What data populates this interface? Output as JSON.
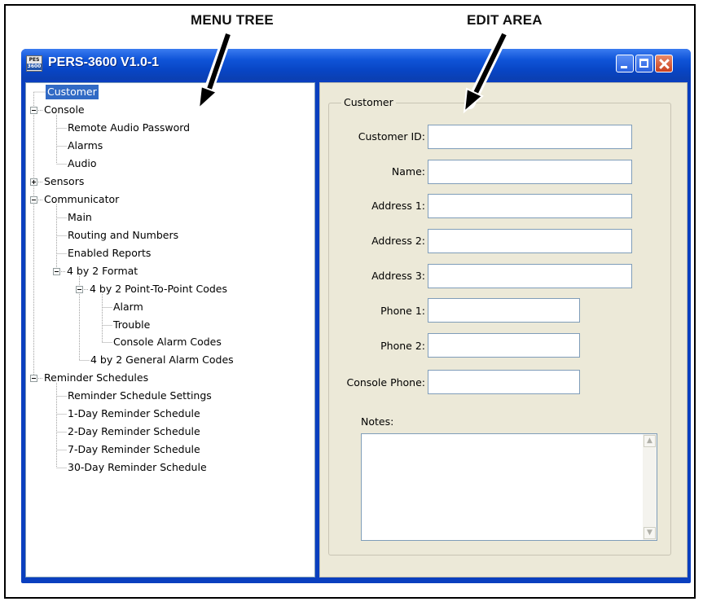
{
  "callouts": {
    "menu_tree": "MENU TREE",
    "edit_area": "EDIT AREA"
  },
  "window": {
    "title": "PERS-3600 V1.0-1",
    "icon_text_top": "PES",
    "icon_text_bottom": "3600",
    "icons": [
      "app-icon",
      "minimize-icon",
      "maximize-icon",
      "close-icon"
    ]
  },
  "tree": {
    "items": [
      {
        "label": "Customer",
        "selected": true
      },
      {
        "label": "Console",
        "expander": "minus"
      },
      {
        "label": "Remote Audio Password"
      },
      {
        "label": "Alarms"
      },
      {
        "label": "Audio"
      },
      {
        "label": "Sensors",
        "expander": "plus"
      },
      {
        "label": "Communicator",
        "expander": "minus"
      },
      {
        "label": "Main"
      },
      {
        "label": "Routing and Numbers"
      },
      {
        "label": "Enabled Reports"
      },
      {
        "label": "4 by 2 Format",
        "expander": "minus"
      },
      {
        "label": "4 by 2 Point-To-Point Codes",
        "expander": "minus"
      },
      {
        "label": "Alarm"
      },
      {
        "label": "Trouble"
      },
      {
        "label": "Console Alarm Codes"
      },
      {
        "label": "4 by 2 General Alarm Codes"
      },
      {
        "label": "Reminder Schedules",
        "expander": "minus"
      },
      {
        "label": "Reminder Schedule Settings"
      },
      {
        "label": "1-Day Reminder Schedule"
      },
      {
        "label": "2-Day Reminder Schedule"
      },
      {
        "label": "7-Day Reminder Schedule"
      },
      {
        "label": "30-Day Reminder Schedule"
      }
    ]
  },
  "edit": {
    "group_title": "Customer",
    "fields": [
      {
        "label": "Customer ID:",
        "value": ""
      },
      {
        "label": "Name:",
        "value": ""
      },
      {
        "label": "Address 1:",
        "value": ""
      },
      {
        "label": "Address 2:",
        "value": ""
      },
      {
        "label": "Address 3:",
        "value": ""
      },
      {
        "label": "Phone 1:",
        "value": ""
      },
      {
        "label": "Phone 2:",
        "value": ""
      },
      {
        "label": "Console Phone:",
        "value": ""
      }
    ],
    "notes_label": "Notes:",
    "notes_value": ""
  },
  "colors": {
    "titlebar": "#0f54d8",
    "selection": "#316ac5",
    "panel": "#ece9d8",
    "close_button": "#c9401e"
  }
}
